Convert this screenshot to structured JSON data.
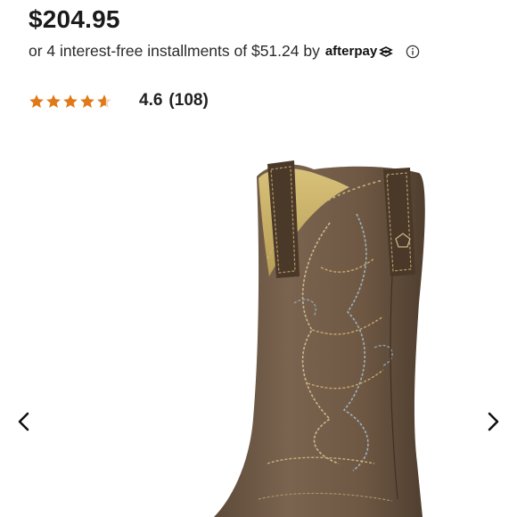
{
  "product": {
    "price": "$204.95",
    "installment_text": "or 4 interest-free installments of $51.24 by",
    "afterpay_label": "afterpay",
    "rating_value": "4.6",
    "review_count": "(108)",
    "rating_stars": 4.6,
    "star_color": "#e07a18"
  },
  "gallery": {
    "image_subject": "brown western cowboy boot with decorative stitching",
    "prev_icon": "chevron-left-icon",
    "next_icon": "chevron-right-icon"
  }
}
